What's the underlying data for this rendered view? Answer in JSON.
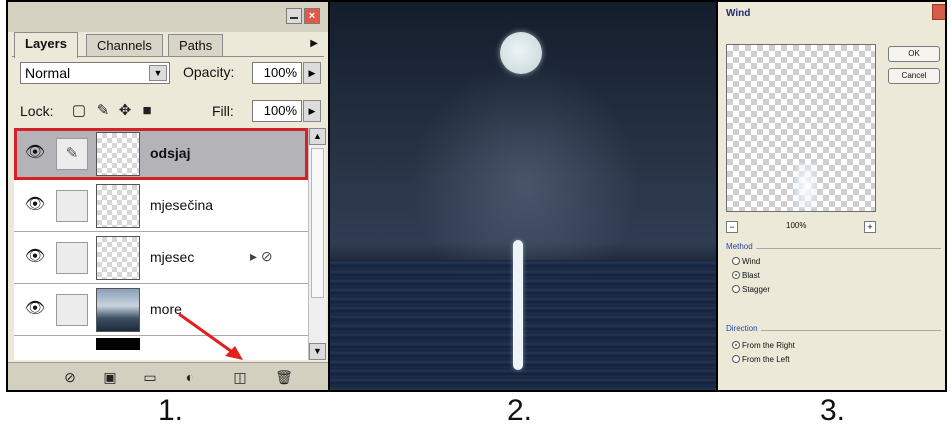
{
  "layers_panel": {
    "tabs": [
      "Layers",
      "Channels",
      "Paths"
    ],
    "blend_mode": "Normal",
    "opacity_label": "Opacity:",
    "opacity_value": "100%",
    "lock_label": "Lock:",
    "fill_label": "Fill:",
    "fill_value": "100%",
    "layers": [
      {
        "name": "odsjaj",
        "selected": true
      },
      {
        "name": "mjesečina",
        "selected": false
      },
      {
        "name": "mjesec",
        "selected": false
      },
      {
        "name": "more",
        "selected": false
      }
    ],
    "toolbar_icons": [
      "link-layers-icon",
      "layer-style-icon",
      "layer-mask-icon",
      "adjustment-layer-icon",
      "new-group-icon",
      "new-layer-icon",
      "trash-icon"
    ],
    "highlight_color": "#d42028"
  },
  "wind_dialog": {
    "title": "Wind",
    "ok_label": "OK",
    "cancel_label": "Cancel",
    "zoom": "100%",
    "method_label": "Method",
    "methods": [
      "Wind",
      "Blast",
      "Stagger"
    ],
    "method_selected": "Blast",
    "direction_label": "Direction",
    "directions": [
      "From the Right",
      "From the Left"
    ],
    "direction_selected": "From the Right"
  },
  "captions": [
    "1.",
    "2.",
    "3."
  ]
}
